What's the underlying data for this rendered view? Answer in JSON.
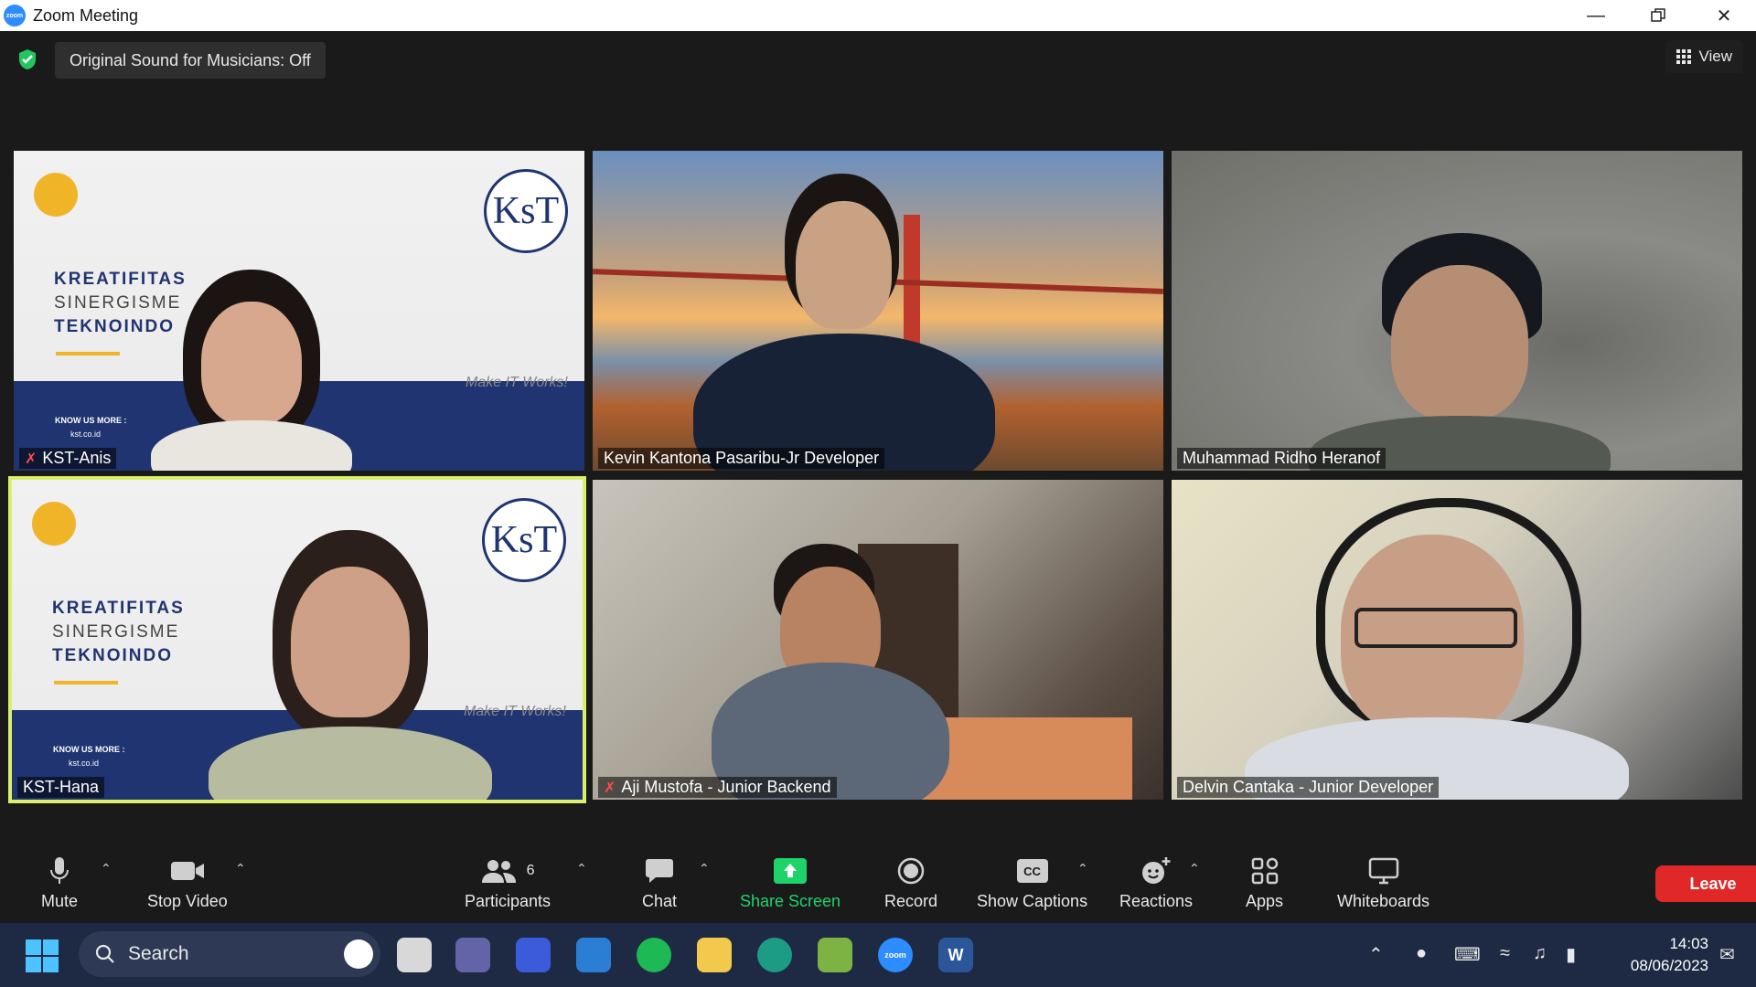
{
  "window": {
    "title": "Zoom Meeting",
    "app_icon_text": "zoom"
  },
  "banner": {
    "original_sound": "Original Sound for Musicians: Off",
    "view_label": "View"
  },
  "tiles": [
    {
      "name": "KST-Anis",
      "muted": true
    },
    {
      "name": "Kevin Kantona Pasaribu-Jr Developer",
      "muted": false
    },
    {
      "name": "Muhammad Ridho Heranof",
      "muted": false
    },
    {
      "name": "KST-Hana",
      "muted": false,
      "active": true
    },
    {
      "name": "Aji Mustofa - Junior Backend",
      "muted": true
    },
    {
      "name": "Delvin Cantaka - Junior Developer",
      "muted": false
    }
  ],
  "kst_background": {
    "logo": "KsT",
    "line1": "KREATIFITAS",
    "line2": "SINERGISME",
    "line3": "TEKNOINDO",
    "tagline": "Make IT Works!",
    "know_us": "KNOW US MORE :",
    "site": "kst.co.id"
  },
  "toolbar": {
    "mute": "Mute",
    "stop_video": "Stop Video",
    "participants": "Participants",
    "participants_count": "6",
    "chat": "Chat",
    "share_screen": "Share Screen",
    "record": "Record",
    "show_captions": "Show Captions",
    "reactions": "Reactions",
    "apps": "Apps",
    "whiteboards": "Whiteboards",
    "leave": "Leave",
    "caption_icon_text": "CC"
  },
  "taskbar": {
    "search_placeholder": "Search",
    "time": "14:03",
    "date": "08/06/2023",
    "zoom_label": "zoom",
    "word_label": "W"
  },
  "colors": {
    "share_green": "#1fd36b",
    "leave_red": "#e02828",
    "active_border": "#d9f06a",
    "shield_green": "#22c55e"
  }
}
